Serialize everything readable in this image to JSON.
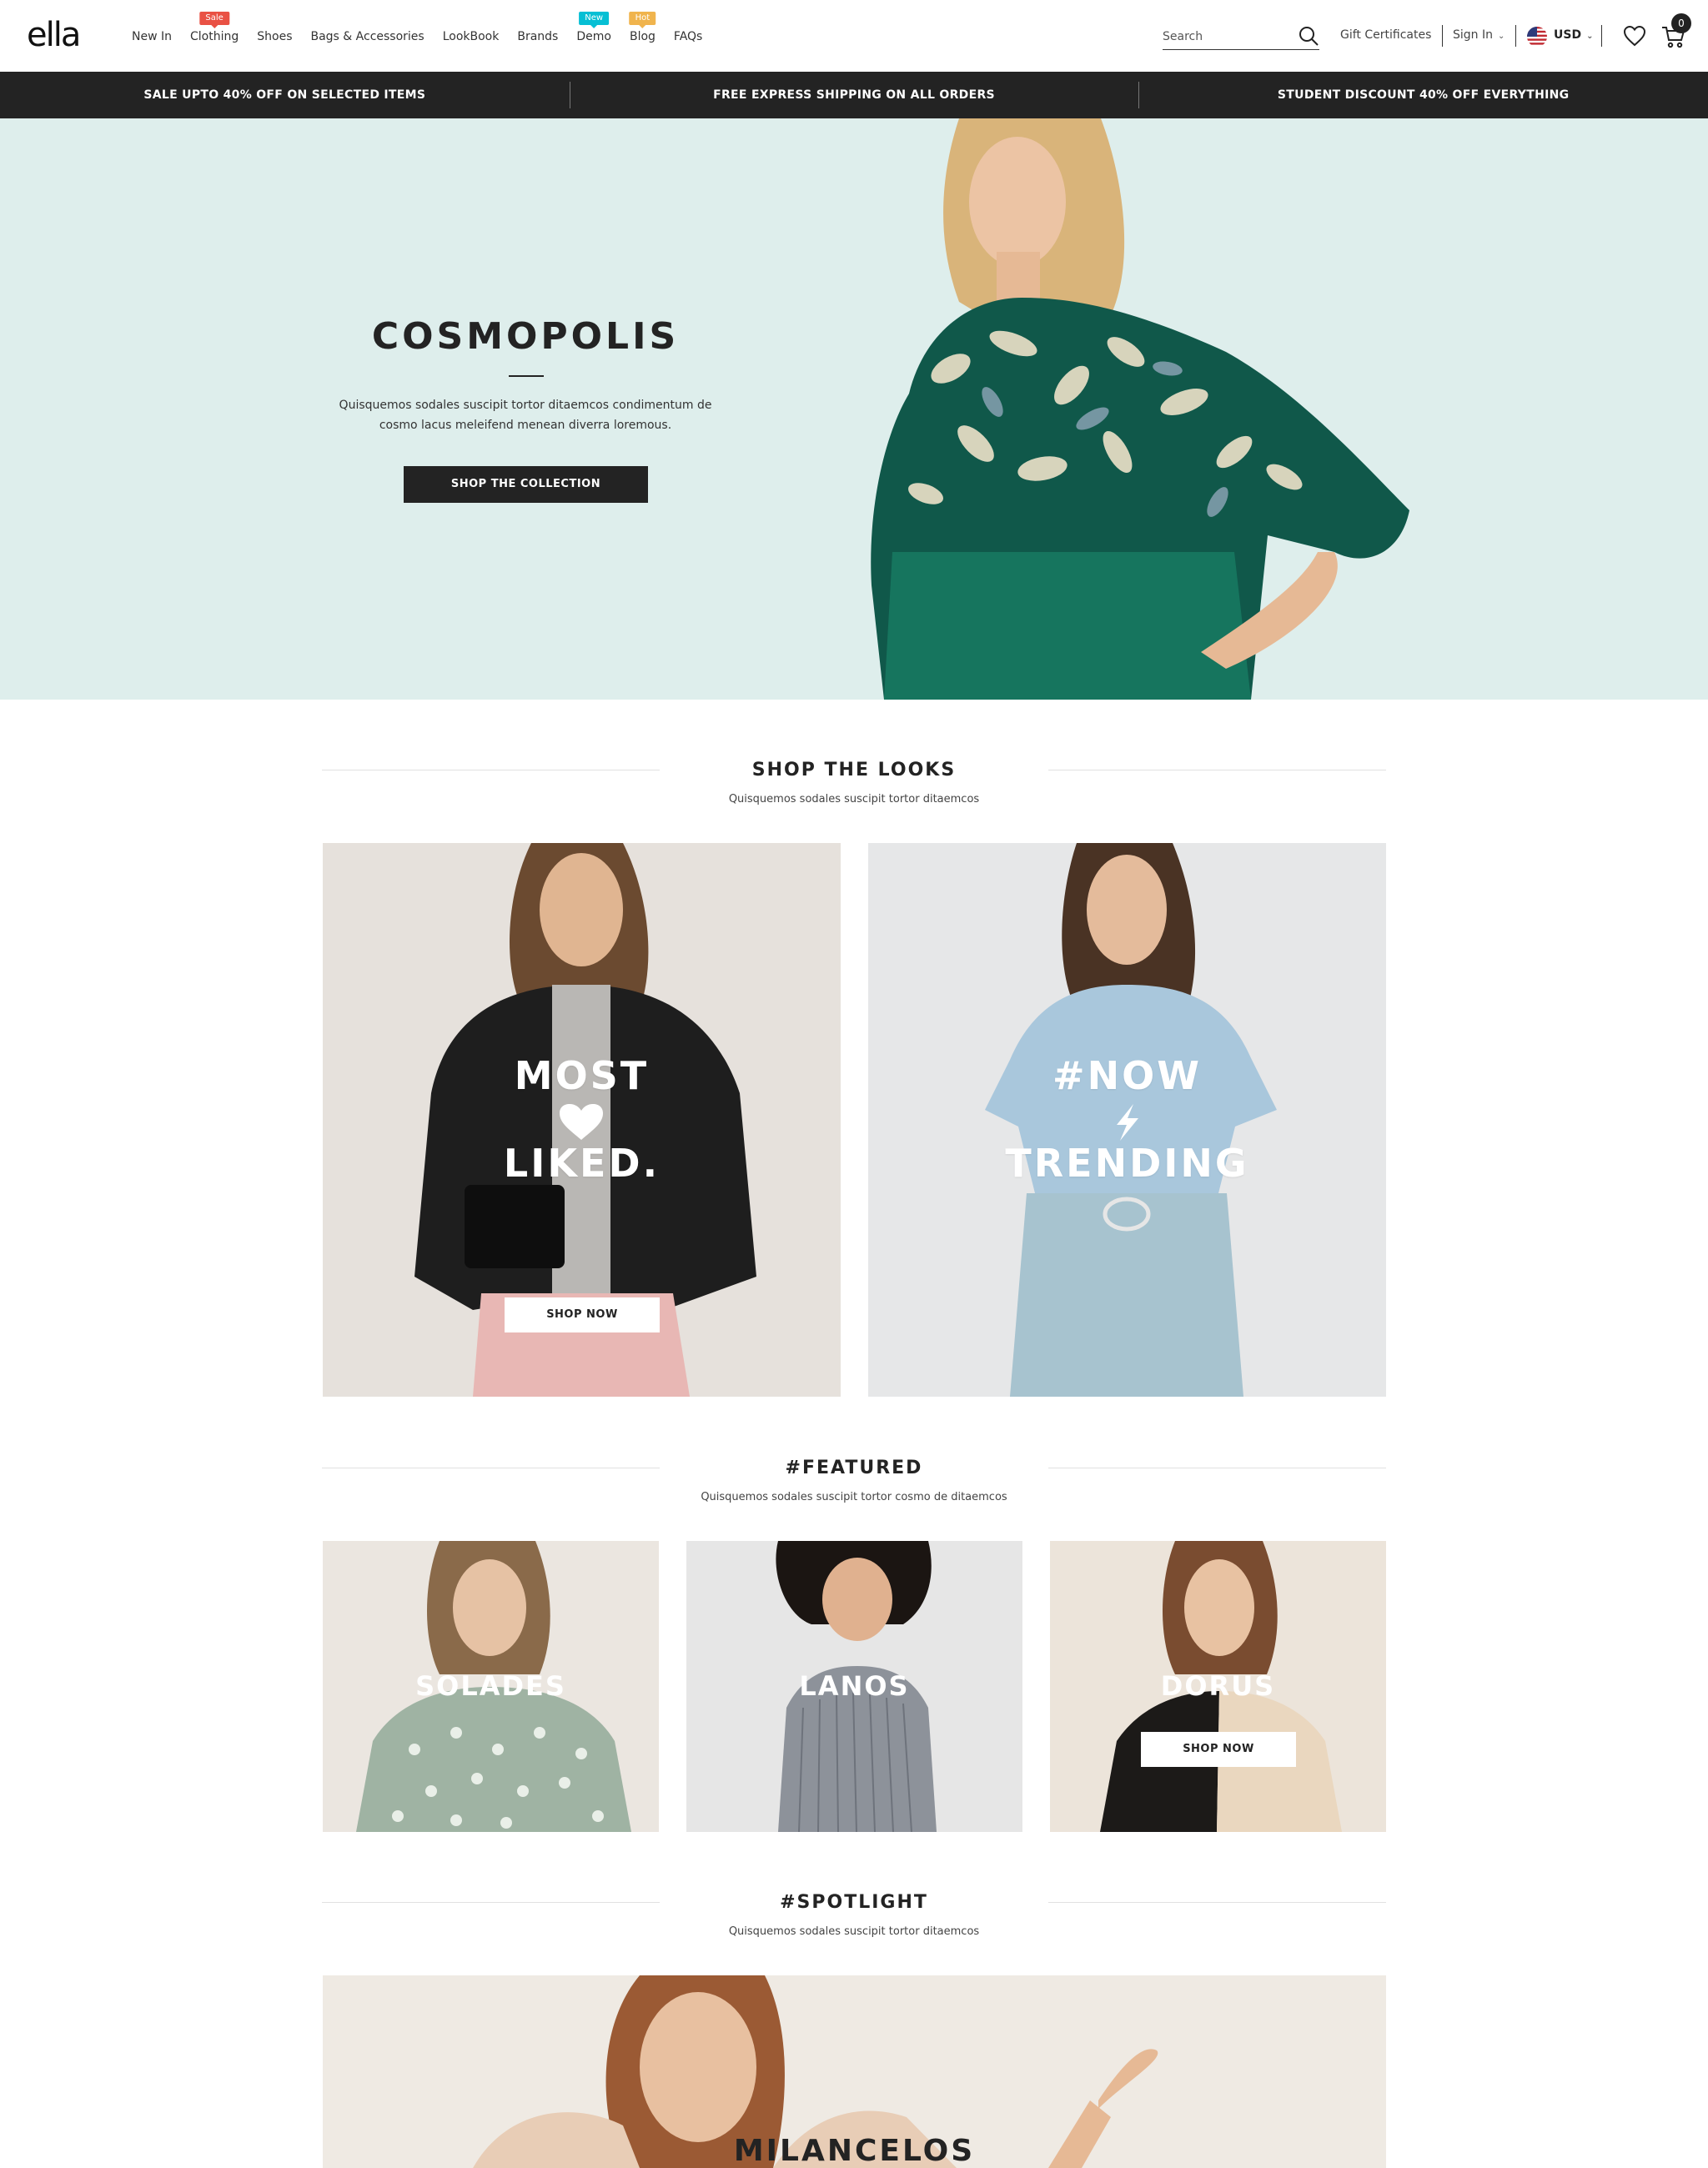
{
  "header": {
    "logo": "ella",
    "nav": [
      {
        "label": "New In"
      },
      {
        "label": "Clothing",
        "badge": "Sale"
      },
      {
        "label": "Shoes"
      },
      {
        "label": "Bags & Accessories"
      },
      {
        "label": "LookBook"
      },
      {
        "label": "Brands"
      },
      {
        "label": "Demo",
        "badge": "New"
      },
      {
        "label": "Blog",
        "badge": "Hot"
      },
      {
        "label": "FAQs"
      }
    ],
    "search_placeholder": "Search",
    "gift_label": "Gift Certificates",
    "signin_label": "Sign In",
    "currency": "USD",
    "cart_count": "0"
  },
  "promo": [
    "SALE UPTO 40% OFF ON SELECTED ITEMS",
    "FREE EXPRESS SHIPPING ON ALL ORDERS",
    "STUDENT DISCOUNT 40% OFF EVERYTHING"
  ],
  "hero": {
    "title": "COSMOPOLIS",
    "text": "Quisquemos sodales suscipit tortor ditaemcos condimentum de cosmo lacus meleifend menean diverra loremous.",
    "button": "SHOP THE COLLECTION",
    "bg_color": "#deeeec"
  },
  "looks": {
    "title": "SHOP THE LOOKS",
    "subtitle": "Quisquemos sodales suscipit tortor ditaemcos",
    "cards": [
      {
        "line1": "MOST",
        "line2": "LIKED.",
        "icon": "heart-icon",
        "button": "SHOP NOW"
      },
      {
        "line1": "#NOW",
        "line2": "TRENDING",
        "icon": "lightning-icon"
      }
    ]
  },
  "featured": {
    "title": "#FEATURED",
    "subtitle": "Quisquemos sodales suscipit tortor cosmo de ditaemcos",
    "cards": [
      {
        "label": "SOLADES"
      },
      {
        "label": "LANOS"
      },
      {
        "label": "DORUS",
        "button": "SHOP NOW"
      }
    ]
  },
  "spotlight": {
    "title": "#SPOTLIGHT",
    "subtitle": "Quisquemos sodales suscipit tortor ditaemcos",
    "label": "MILANCELOS"
  },
  "colors": {
    "dark": "#232323",
    "sale_badge": "#e95144",
    "new_badge": "#06bfd4",
    "hot_badge": "#f0b44d"
  }
}
